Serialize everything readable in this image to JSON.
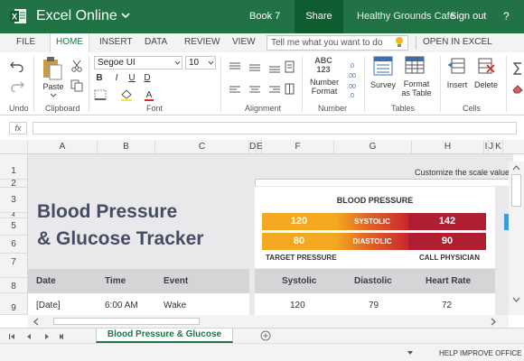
{
  "titlebar": {
    "app_name": "Excel Online",
    "workbook": "Book 7",
    "share": "Share",
    "user": "Healthy Grounds Cafe",
    "signout": "Sign out",
    "help": "?"
  },
  "menu": {
    "tabs": [
      "FILE",
      "HOME",
      "INSERT",
      "DATA",
      "REVIEW",
      "VIEW"
    ],
    "active_tab": "HOME",
    "tell_me": "Tell me what you want to do",
    "open_in_excel": "OPEN IN EXCEL"
  },
  "ribbon": {
    "undo_label": "Undo",
    "clipboard_label": "Clipboard",
    "paste_label": "Paste",
    "font_name": "Segoe UI",
    "font_size": "10",
    "font_label": "Font",
    "bold": "B",
    "italic": "I",
    "underline": "U",
    "double_underline": "D",
    "alignment_label": "Alignment",
    "number_format_line1": "Number",
    "number_format_line2": "Format",
    "number_format_icon_text": "ABC\n123",
    "number_label": "Number",
    "survey_label": "Survey",
    "format_table_line1": "Format",
    "format_table_line2": "as Table",
    "tables_label": "Tables",
    "insert_label": "Insert",
    "delete_label": "Delete",
    "cells_label": "Cells"
  },
  "formula_bar": {
    "fx": "fx",
    "value": ""
  },
  "grid": {
    "columns": [
      "A",
      "B",
      "C",
      "D",
      "E",
      "F",
      "G",
      "H",
      "I",
      "J",
      "K"
    ],
    "rows": [
      "1",
      "2",
      "3",
      "4",
      "5",
      "6",
      "7",
      "8",
      "9"
    ]
  },
  "sheet": {
    "title_line1": "Blood Pressure",
    "title_line2": "& Glucose Tracker",
    "customize": "Customize the scale values",
    "bp": {
      "title": "BLOOD PRESSURE",
      "systolic_target": "120",
      "systolic_label": "SYSTOLIC",
      "systolic_call": "142",
      "diastolic_target": "80",
      "diastolic_label": "DIASTOLIC",
      "diastolic_call": "90",
      "target_label": "TARGET PRESSURE",
      "call_label": "CALL PHYSICIAN"
    },
    "table": {
      "headers": [
        "Date",
        "Time",
        "Event",
        "Systolic",
        "Diastolic",
        "Heart Rate"
      ],
      "rows": [
        [
          "[Date]",
          "6:00 AM",
          "Wake",
          "120",
          "79",
          "72"
        ]
      ]
    }
  },
  "sheet_tab": "Blood Pressure & Glucose",
  "status": {
    "help_improve": "HELP IMPROVE OFFICE"
  },
  "colors": {
    "excel_green": "#217346",
    "title_text": "#464c63",
    "orange": "#f3a81f",
    "red": "#b01e32"
  }
}
